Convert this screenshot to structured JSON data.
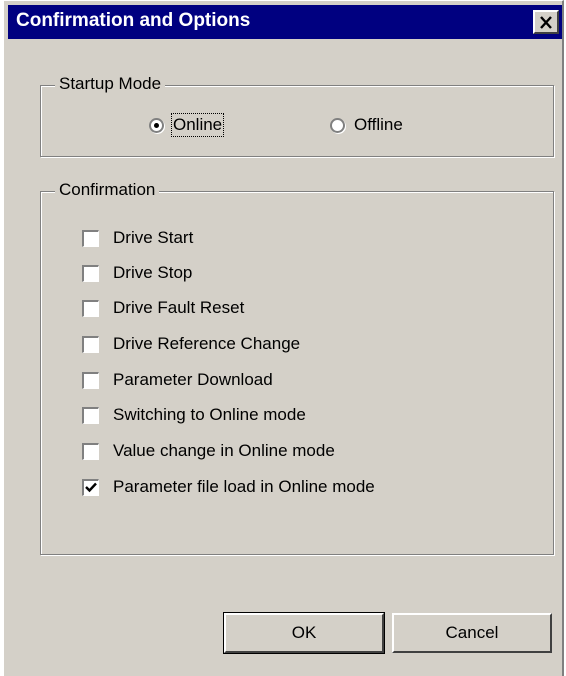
{
  "window": {
    "title": "Confirmation and Options",
    "close_icon": "close-icon"
  },
  "startup_mode": {
    "label": "Startup Mode",
    "options": [
      {
        "label": "Online",
        "selected": true
      },
      {
        "label": "Offline",
        "selected": false
      }
    ]
  },
  "confirmation": {
    "label": "Confirmation",
    "items": [
      {
        "label": "Drive Start",
        "checked": false
      },
      {
        "label": "Drive Stop",
        "checked": false
      },
      {
        "label": "Drive Fault Reset",
        "checked": false
      },
      {
        "label": "Drive Reference Change",
        "checked": false
      },
      {
        "label": "Parameter Download",
        "checked": false
      },
      {
        "label": "Switching to Online mode",
        "checked": false
      },
      {
        "label": "Value change in Online mode",
        "checked": false
      },
      {
        "label": "Parameter file load in Online mode",
        "checked": true
      }
    ]
  },
  "buttons": {
    "ok": "OK",
    "cancel": "Cancel"
  },
  "colors": {
    "title_bar": "#000080",
    "face": "#d4d0c8"
  }
}
